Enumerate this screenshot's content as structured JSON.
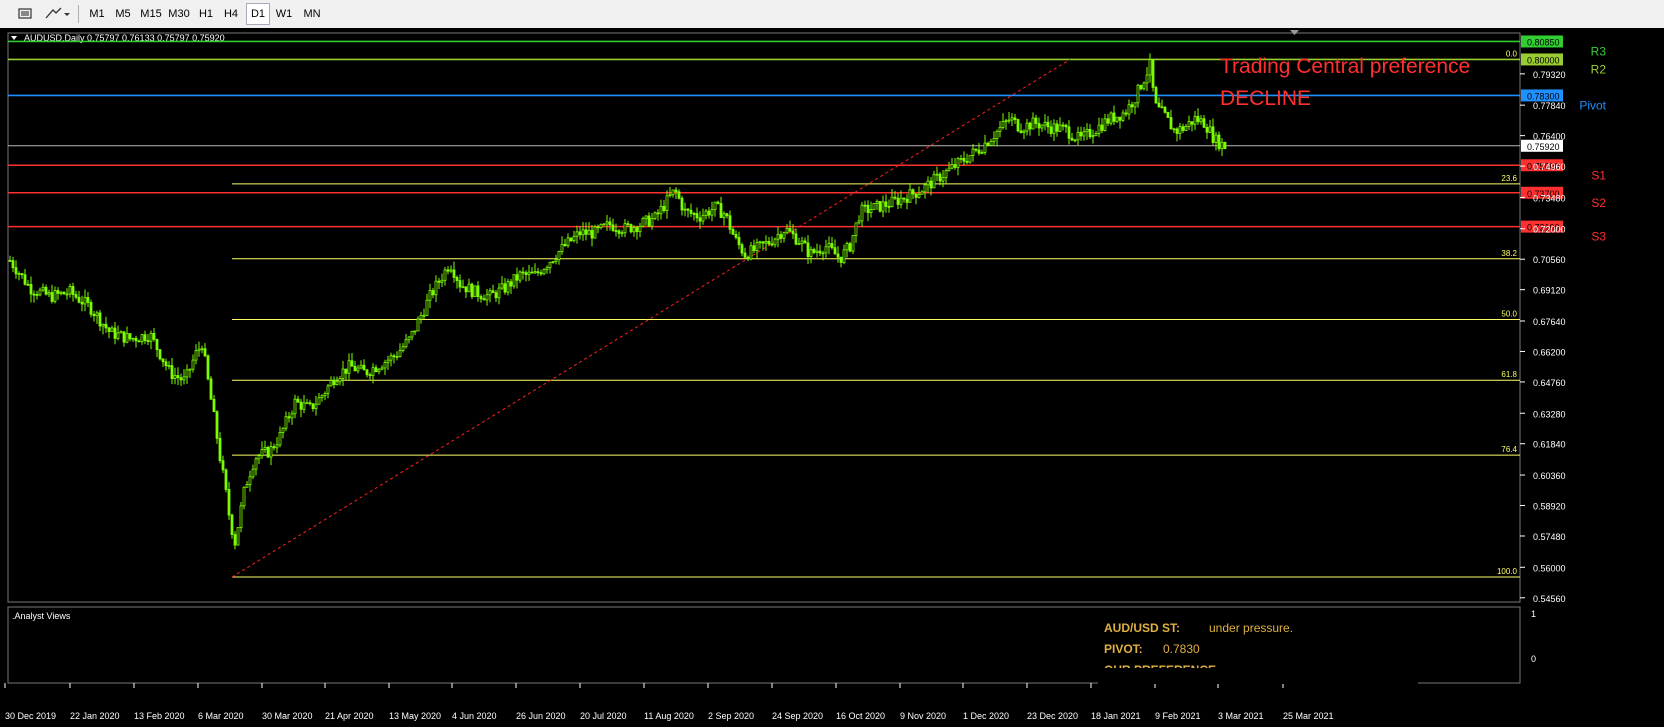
{
  "toolbar": {
    "timeframes": [
      "M1",
      "M5",
      "M15",
      "M30",
      "H1",
      "H4",
      "D1",
      "W1",
      "MN"
    ],
    "active": "D1"
  },
  "chart_data": {
    "type": "candlestick",
    "header": "AUDUSD,Daily  0.75797 0.76133 0.75797 0.75920",
    "y_axis_ticks": [
      "0.79320",
      "0.77840",
      "0.76400",
      "0.74960",
      "0.73480",
      "0.72000",
      "0.70560",
      "0.69120",
      "0.67640",
      "0.66200",
      "0.64760",
      "0.63280",
      "0.61840",
      "0.60360",
      "0.58920",
      "0.57480",
      "0.56000",
      "0.54560"
    ],
    "ylim": [
      0.5436,
      0.8125
    ],
    "x_axis_ticks": [
      "30 Dec 2019",
      "22 Jan 2020",
      "13 Feb 2020",
      "6 Mar 2020",
      "30 Mar 2020",
      "21 Apr 2020",
      "13 May 2020",
      "4 Jun 2020",
      "26 Jun 2020",
      "20 Jul 2020",
      "11 Aug 2020",
      "2 Sep 2020",
      "24 Sep 2020",
      "16 Oct 2020",
      "9 Nov 2020",
      "1 Dec 2020",
      "23 Dec 2020",
      "18 Jan 2021",
      "9 Feb 2021",
      "3 Mar 2021",
      "25 Mar 2021"
    ],
    "price_path": [
      [
        0,
        0.705
      ],
      [
        8,
        0.7
      ],
      [
        20,
        0.692
      ],
      [
        40,
        0.688
      ],
      [
        60,
        0.69
      ],
      [
        80,
        0.683
      ],
      [
        100,
        0.671
      ],
      [
        120,
        0.668
      ],
      [
        140,
        0.67
      ],
      [
        160,
        0.652
      ],
      [
        175,
        0.648
      ],
      [
        185,
        0.66
      ],
      [
        192,
        0.666
      ],
      [
        200,
        0.642
      ],
      [
        205,
        0.628
      ],
      [
        210,
        0.612
      ],
      [
        215,
        0.598
      ],
      [
        220,
        0.582
      ],
      [
        225,
        0.572
      ],
      [
        230,
        0.585
      ],
      [
        235,
        0.598
      ],
      [
        245,
        0.612
      ],
      [
        260,
        0.615
      ],
      [
        270,
        0.622
      ],
      [
        285,
        0.638
      ],
      [
        300,
        0.635
      ],
      [
        310,
        0.64
      ],
      [
        325,
        0.65
      ],
      [
        340,
        0.655
      ],
      [
        355,
        0.652
      ],
      [
        370,
        0.656
      ],
      [
        385,
        0.66
      ],
      [
        400,
        0.668
      ],
      [
        410,
        0.678
      ],
      [
        420,
        0.688
      ],
      [
        430,
        0.696
      ],
      [
        440,
        0.704
      ],
      [
        450,
        0.694
      ],
      [
        465,
        0.69
      ],
      [
        480,
        0.688
      ],
      [
        495,
        0.692
      ],
      [
        510,
        0.698
      ],
      [
        525,
        0.698
      ],
      [
        540,
        0.705
      ],
      [
        555,
        0.712
      ],
      [
        570,
        0.718
      ],
      [
        585,
        0.718
      ],
      [
        600,
        0.722
      ],
      [
        615,
        0.72
      ],
      [
        630,
        0.722
      ],
      [
        645,
        0.725
      ],
      [
        660,
        0.735
      ],
      [
        665,
        0.738
      ],
      [
        675,
        0.728
      ],
      [
        690,
        0.726
      ],
      [
        705,
        0.73
      ],
      [
        715,
        0.727
      ],
      [
        725,
        0.715
      ],
      [
        735,
        0.708
      ],
      [
        745,
        0.71
      ],
      [
        760,
        0.714
      ],
      [
        775,
        0.72
      ],
      [
        790,
        0.714
      ],
      [
        800,
        0.708
      ],
      [
        815,
        0.712
      ],
      [
        830,
        0.706
      ],
      [
        840,
        0.712
      ],
      [
        850,
        0.728
      ],
      [
        865,
        0.73
      ],
      [
        880,
        0.732
      ],
      [
        895,
        0.735
      ],
      [
        910,
        0.738
      ],
      [
        925,
        0.743
      ],
      [
        940,
        0.748
      ],
      [
        955,
        0.753
      ],
      [
        970,
        0.758
      ],
      [
        985,
        0.765
      ],
      [
        1000,
        0.772
      ],
      [
        1010,
        0.768
      ],
      [
        1025,
        0.77
      ],
      [
        1040,
        0.768
      ],
      [
        1055,
        0.767
      ],
      [
        1070,
        0.762
      ],
      [
        1085,
        0.767
      ],
      [
        1100,
        0.772
      ],
      [
        1115,
        0.775
      ],
      [
        1125,
        0.782
      ],
      [
        1135,
        0.792
      ],
      [
        1140,
        0.797
      ],
      [
        1145,
        0.778
      ],
      [
        1155,
        0.773
      ],
      [
        1165,
        0.766
      ],
      [
        1175,
        0.768
      ],
      [
        1185,
        0.772
      ],
      [
        1195,
        0.77
      ],
      [
        1205,
        0.762
      ],
      [
        1215,
        0.759
      ]
    ],
    "levels": [
      {
        "label": "R3",
        "value": 0.8085,
        "tag": "0.80850",
        "color": "#32cd32"
      },
      {
        "label": "R2",
        "value": 0.8,
        "tag": "0.80000",
        "color": "#9acd32"
      },
      {
        "label": "Pivot",
        "value": 0.783,
        "tag": "0.78300",
        "color": "#1e90ff"
      },
      {
        "label": "S1",
        "value": 0.75,
        "tag": "0.75000",
        "color": "#ff3030"
      },
      {
        "label": "S2",
        "value": 0.737,
        "tag": "0.73700",
        "color": "#ff3030"
      },
      {
        "label": "S3",
        "value": 0.721,
        "tag": "0.72100",
        "color": "#ff3030"
      }
    ],
    "current_price": {
      "value": 0.7592,
      "tag": "0.75920"
    },
    "fibonacci": [
      {
        "label": "0.0",
        "value": 0.8
      },
      {
        "label": "23.6",
        "value": 0.7412
      },
      {
        "label": "38.2",
        "value": 0.7058
      },
      {
        "label": "50.0",
        "value": 0.6771
      },
      {
        "label": "61.8",
        "value": 0.6484
      },
      {
        "label": "76.4",
        "value": 0.613
      },
      {
        "label": "100.0",
        "value": 0.5554
      }
    ],
    "trendline": {
      "from": [
        222,
        0.5554
      ],
      "to": [
        1060,
        0.8
      ]
    },
    "annotations": [
      "Trading Central preference",
      "DECLINE"
    ]
  },
  "subwindow": {
    "title": ".Analyst Views",
    "y_ticks": [
      "1",
      "0"
    ],
    "line1_label": "AUD/USD ST:",
    "line1_value": "under pressure.",
    "line2_label": "PIVOT:",
    "line2_value": "0.7830",
    "line3_partial": "OUR PREFERENCE"
  },
  "colors": {
    "background": "#000000",
    "candle": "#7cfc00",
    "fib": "#ffff66",
    "text_orange": "#e0b040",
    "axis": "#ffffff",
    "trendline": "#ff2020"
  }
}
